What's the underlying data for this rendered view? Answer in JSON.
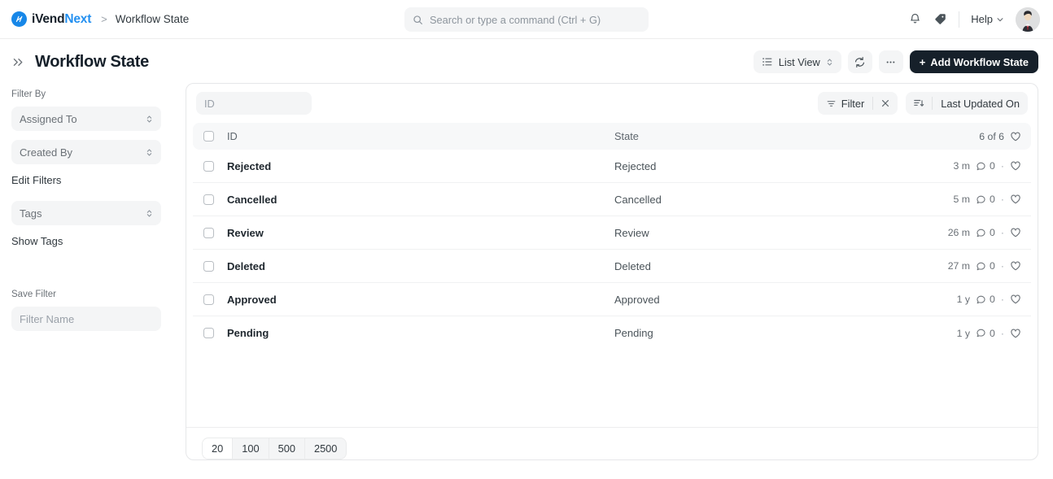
{
  "navbar": {
    "brand_dark": "iVend",
    "brand_blue": "Next",
    "breadcrumb_separator": ">",
    "breadcrumb_title": "Workflow State",
    "search_placeholder": "Search or type a command (Ctrl + G)",
    "search_value": "",
    "help_label": "Help"
  },
  "page": {
    "title": "Workflow State",
    "view_label": "List View",
    "add_button_label": "Add Workflow State",
    "add_button_plus": "+"
  },
  "sidebar": {
    "filter_by_label": "Filter By",
    "assigned_to": "Assigned To",
    "created_by": "Created By",
    "edit_filters": "Edit Filters",
    "tags": "Tags",
    "show_tags": "Show Tags",
    "save_filter_label": "Save Filter",
    "filter_name_placeholder": "Filter Name",
    "filter_name_value": ""
  },
  "toolbar": {
    "id_placeholder": "ID",
    "id_value": "",
    "filter_label": "Filter",
    "clear_label": "×",
    "sort_label": "Last Updated On"
  },
  "list": {
    "columns": {
      "id": "ID",
      "state": "State"
    },
    "count_label": "6 of 6",
    "rows": [
      {
        "id": "Rejected",
        "state": "Rejected",
        "modified": "3 m",
        "comments": "0"
      },
      {
        "id": "Cancelled",
        "state": "Cancelled",
        "modified": "5 m",
        "comments": "0"
      },
      {
        "id": "Review",
        "state": "Review",
        "modified": "26 m",
        "comments": "0"
      },
      {
        "id": "Deleted",
        "state": "Deleted",
        "modified": "27 m",
        "comments": "0"
      },
      {
        "id": "Approved",
        "state": "Approved",
        "modified": "1 y",
        "comments": "0"
      },
      {
        "id": "Pending",
        "state": "Pending",
        "modified": "1 y",
        "comments": "0"
      }
    ],
    "dot": "·"
  },
  "pagination": {
    "options": [
      "20",
      "100",
      "500",
      "2500"
    ],
    "selected": "20"
  },
  "colors": {
    "brand_blue": "#2490f0",
    "logo_blue": "#1787e8",
    "dark_button": "#16202a",
    "grey_surface": "#f4f5f6",
    "text_primary": "#1f272e",
    "text_muted": "#6b7177"
  }
}
